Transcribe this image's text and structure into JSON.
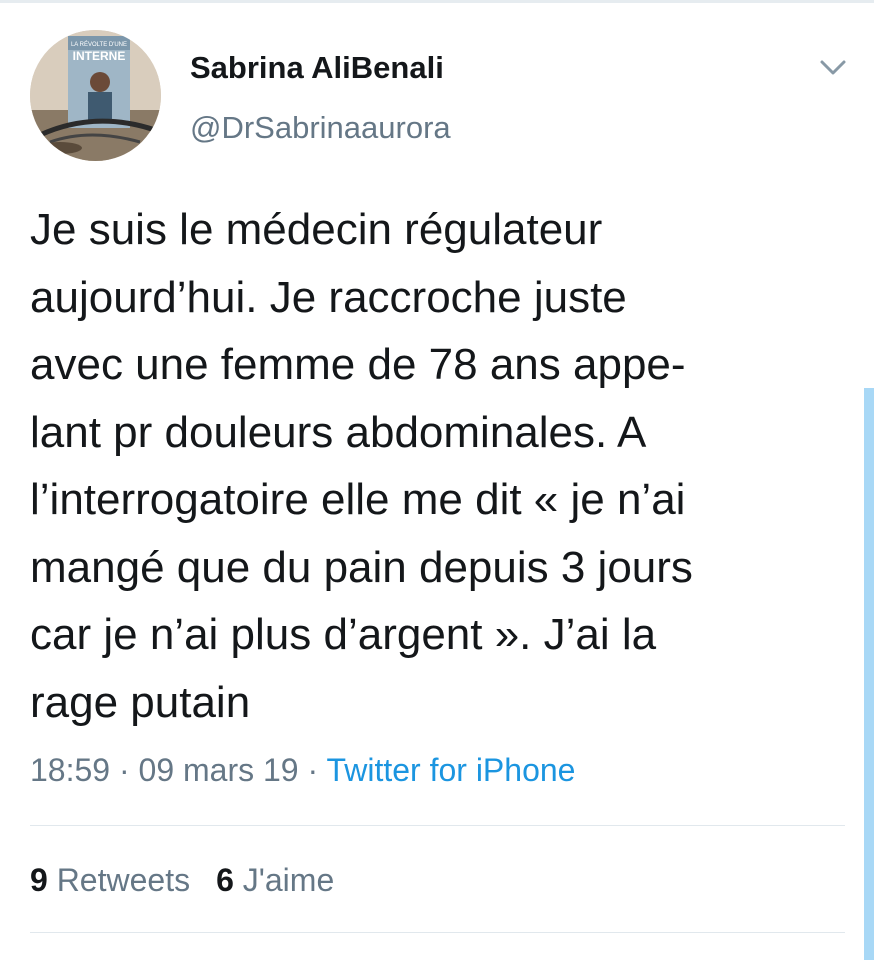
{
  "tweet": {
    "author": {
      "display_name": "Sabrina AliBenali",
      "handle": "@DrSabrinaaurora",
      "avatar_book_title": "INTERNE",
      "avatar_book_supertitle": "LA RÉVOLTE D'UNE"
    },
    "text_lines": [
      "Je suis le médecin régulateur",
      "aujourd’hui. Je raccroche juste",
      "avec une femme de 78 ans appe-",
      "lant pr douleurs abdominales. A",
      "l’interrogatoire elle me dit « je n’ai",
      "mangé que du pain depuis 3 jours",
      "car je n’ai plus d’argent ». J’ai la",
      "rage putain"
    ],
    "time": "18:59",
    "separator": "·",
    "date": "09 mars 19",
    "source": "Twitter for iPhone",
    "retweets_count": "9",
    "retweets_label": "Retweets",
    "likes_count": "6",
    "likes_label": "J'aime"
  },
  "icons": {
    "menu": "chevron-down-icon"
  },
  "colors": {
    "text": "#14171a",
    "secondary": "#657786",
    "link": "#1b95e0",
    "divider": "#e1e8ed",
    "scrollbar": "#a8d8f6"
  }
}
